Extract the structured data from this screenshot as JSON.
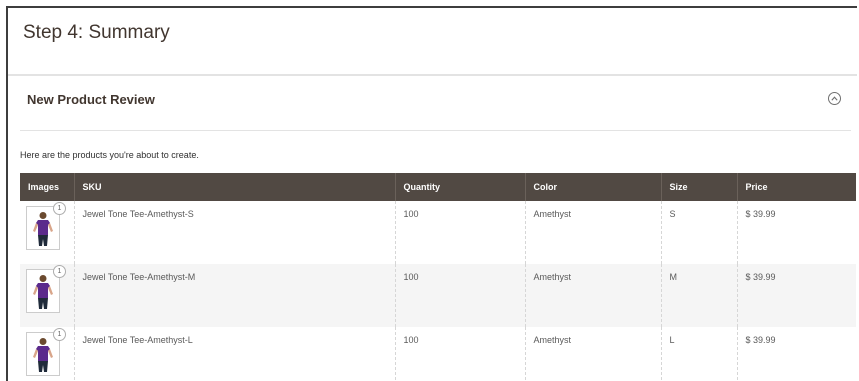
{
  "step": {
    "title": "Step 4: Summary"
  },
  "section": {
    "title": "New Product Review",
    "collapse_icon": "chevron-up-circle-icon"
  },
  "intro_text": "Here are the products you're about to create.",
  "table": {
    "headers": {
      "images": "Images",
      "sku": "SKU",
      "quantity": "Quantity",
      "color": "Color",
      "size": "Size",
      "price": "Price"
    },
    "rows": [
      {
        "sku": "Jewel Tone Tee-Amethyst-S",
        "quantity": "100",
        "color": "Amethyst",
        "size": "S",
        "price": "$ 39.99",
        "image_count": "1"
      },
      {
        "sku": "Jewel Tone Tee-Amethyst-M",
        "quantity": "100",
        "color": "Amethyst",
        "size": "M",
        "price": "$ 39.99",
        "image_count": "1"
      },
      {
        "sku": "Jewel Tone Tee-Amethyst-L",
        "quantity": "100",
        "color": "Amethyst",
        "size": "L",
        "price": "$ 39.99",
        "image_count": "1"
      }
    ]
  },
  "colors": {
    "header_bg": "#514943",
    "shirt": "#5b2a8c",
    "alt_row": "#f5f5f5"
  }
}
